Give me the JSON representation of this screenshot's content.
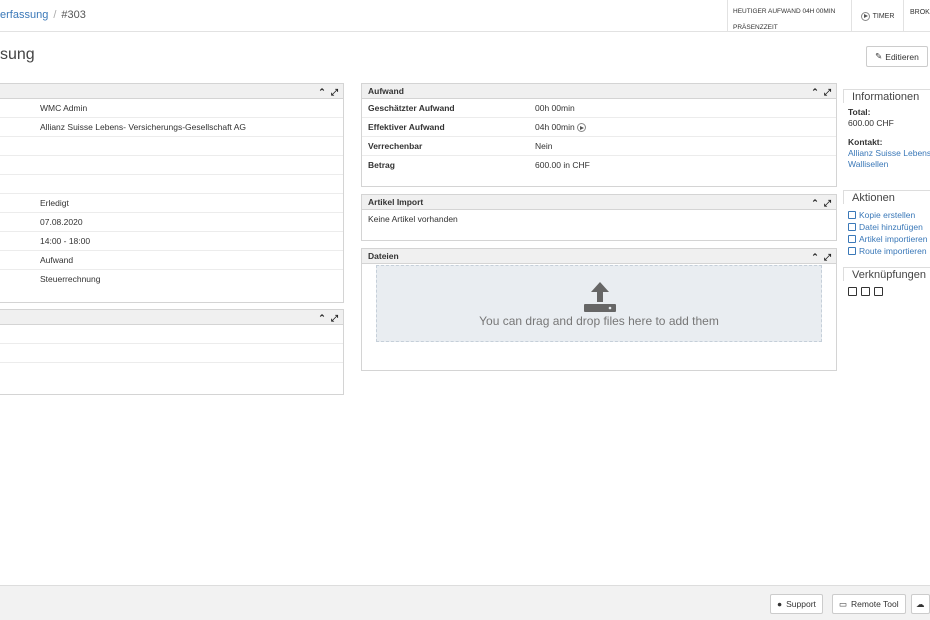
{
  "breadcrumb": {
    "parent": "erfassung",
    "separator": "/",
    "current": "#303"
  },
  "topbar": {
    "stat_line1": "HEUTIGER AUFWAND 04H 00MIN",
    "stat_line2": "PRÄSENZZEIT",
    "timer": "TIMER",
    "brok": "BROK"
  },
  "title": "sung",
  "edit_label": "Editieren",
  "left_panel": {
    "rows": [
      {
        "value": "WMC Admin"
      },
      {
        "value": "Allianz Suisse Lebens- Versicherungs-Gesellschaft AG"
      },
      {
        "value": ""
      },
      {
        "value": ""
      },
      {
        "value": ""
      },
      {
        "value": "Erledigt"
      },
      {
        "value": "07.08.2020"
      },
      {
        "value": "14:00 - 18:00"
      },
      {
        "value": "Aufwand"
      },
      {
        "value": "Steuerrechnung"
      }
    ]
  },
  "aufwand": {
    "title": "Aufwand",
    "rows": [
      {
        "label": "Geschätzter Aufwand",
        "value": "00h 00min"
      },
      {
        "label": "Effektiver Aufwand",
        "value": "04h 00min"
      },
      {
        "label": "Verrechenbar",
        "value": "Nein"
      },
      {
        "label": "Betrag",
        "value": "600.00 in CHF"
      }
    ]
  },
  "artikel": {
    "title": "Artikel Import",
    "empty": "Keine Artikel vorhanden"
  },
  "dateien": {
    "title": "Dateien",
    "drop_text": "You can drag and drop files here to add them"
  },
  "info": {
    "title": "Informationen",
    "total_label": "Total:",
    "total_value": "600.00 CHF",
    "kontakt_label": "Kontakt:",
    "kontakt_line1": "Allianz Suisse Lebens",
    "kontakt_line2": "Wallisellen"
  },
  "aktionen": {
    "title": "Aktionen",
    "items": [
      {
        "label": "Kopie erstellen",
        "icon": "copy-icon"
      },
      {
        "label": "Datei hinzufügen",
        "icon": "file-icon"
      },
      {
        "label": "Artikel importieren",
        "icon": "edit-icon"
      },
      {
        "label": "Route importieren",
        "icon": "edit-icon"
      }
    ]
  },
  "verknuepfungen": {
    "title": "Verknüpfungen",
    "icons": [
      "note-icon",
      "checkbox-icon",
      "calendar-icon"
    ]
  },
  "footer": {
    "support": "Support",
    "remote": "Remote Tool"
  }
}
